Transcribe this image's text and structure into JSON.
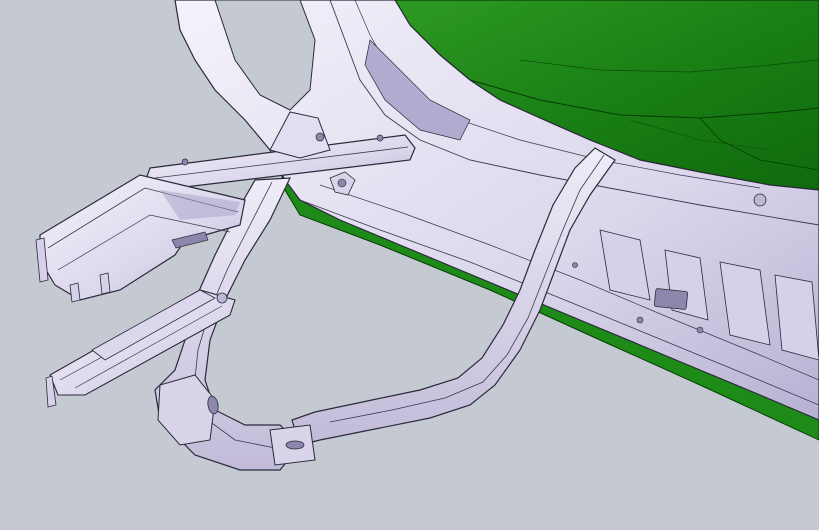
{
  "scene": {
    "background_color": "#c5cad2",
    "colors": {
      "frame_metal": "#e6e3f2",
      "frame_shade": "#c9c4dd",
      "frame_edge": "#2a2a3a",
      "body_green": "#1f8a1a",
      "body_green_dark": "#0d5e0b",
      "body_green_light": "#3aa82e",
      "hood_light": "#f1eef8",
      "shadow_violet": "#a79fc6"
    },
    "parts": [
      "rear-frame-upper",
      "green-body-panel",
      "green-lower-trim",
      "lower-frame-rail",
      "curved-hoop-rail",
      "side-frame-loop",
      "top-bracket",
      "left-clip-bracket",
      "lower-arm-bracket"
    ]
  }
}
